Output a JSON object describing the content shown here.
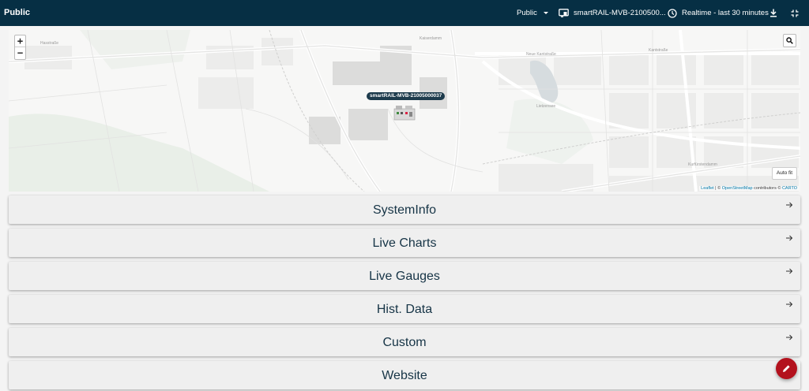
{
  "topbar": {
    "brand": "Public",
    "dashboard_select": "Public",
    "device": "smartRAIL-MVB-2100500...",
    "timerange": "Realtime - last 30 minutes",
    "icons": {
      "device": "device-monitor-icon",
      "time": "clock-icon",
      "download": "download-icon",
      "fullscreen": "exit-fullscreen-icon"
    }
  },
  "map": {
    "zoom_in": "+",
    "zoom_out": "−",
    "marker_label": "smartRAIL-MVB-21005000037",
    "autofit": "Auto fit",
    "attribution": {
      "leaflet": "Leaflet",
      "sep1": " | © ",
      "osm": "OpenStreetMap",
      "mid": " contributors © ",
      "carto": "CARTO"
    },
    "street_labels": [
      "Hasstraße",
      "Neue Kantstraße",
      "Kantstraße",
      "Kaiserdamm",
      "Lietzensee",
      "Kurfürstendamm"
    ]
  },
  "panels": [
    {
      "label": "SystemInfo"
    },
    {
      "label": "Live Charts"
    },
    {
      "label": "Live Gauges"
    },
    {
      "label": "Hist. Data"
    },
    {
      "label": "Custom"
    },
    {
      "label": "Website"
    }
  ],
  "colors": {
    "topbar": "#062f44",
    "panel_text": "#163446",
    "fab": "#b3111d"
  }
}
